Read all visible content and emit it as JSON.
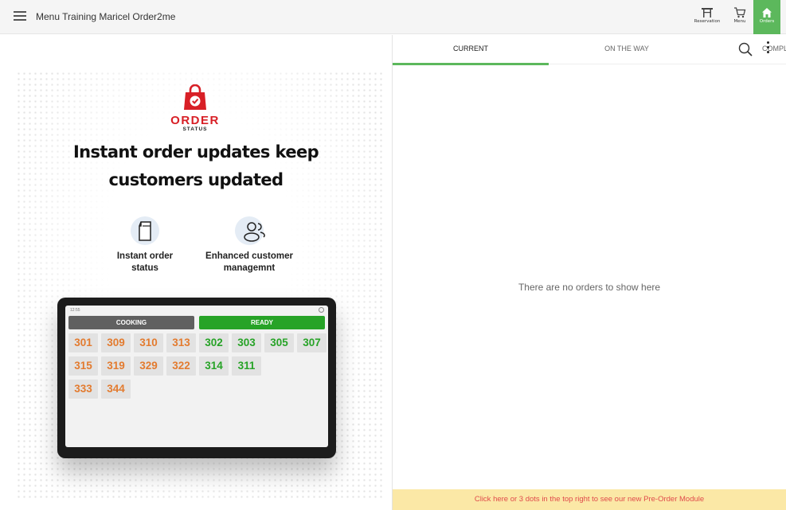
{
  "header": {
    "title": "Menu Training Maricel Order2me",
    "nav": [
      {
        "label": "Reservation",
        "icon": "table-icon"
      },
      {
        "label": "Menu",
        "icon": "cart-icon"
      },
      {
        "label": "Orders",
        "icon": "home-icon",
        "active": true
      }
    ],
    "accent": "#5cb85c"
  },
  "promo": {
    "logo_word": "ORDER",
    "logo_sub": "STATUS",
    "headline_line1": "Instant order updates keep",
    "headline_line2": "customers updated",
    "features": [
      {
        "label_line1": "Instant order",
        "label_line2": "status",
        "icon": "bag-icon"
      },
      {
        "label_line1": "Enhanced customer",
        "label_line2": "managemnt",
        "icon": "users-icon"
      }
    ],
    "tablet": {
      "time": "12:55",
      "cooking_label": "COOKING",
      "ready_label": "READY",
      "cooking": [
        "301",
        "309",
        "310",
        "313",
        "315",
        "319",
        "329",
        "322",
        "333",
        "344"
      ],
      "ready": [
        "302",
        "303",
        "305",
        "307",
        "314",
        "311"
      ],
      "cooking_color": "#e37b2f",
      "ready_color": "#27a327"
    }
  },
  "orders": {
    "tabs": [
      {
        "label": "CURRENT",
        "active": true
      },
      {
        "label": "ON THE WAY"
      },
      {
        "label": "COMPLETED"
      }
    ],
    "empty_message": "There are no orders to show here",
    "banner": "Click here or 3 dots in the top right to see our new Pre-Order Module"
  }
}
